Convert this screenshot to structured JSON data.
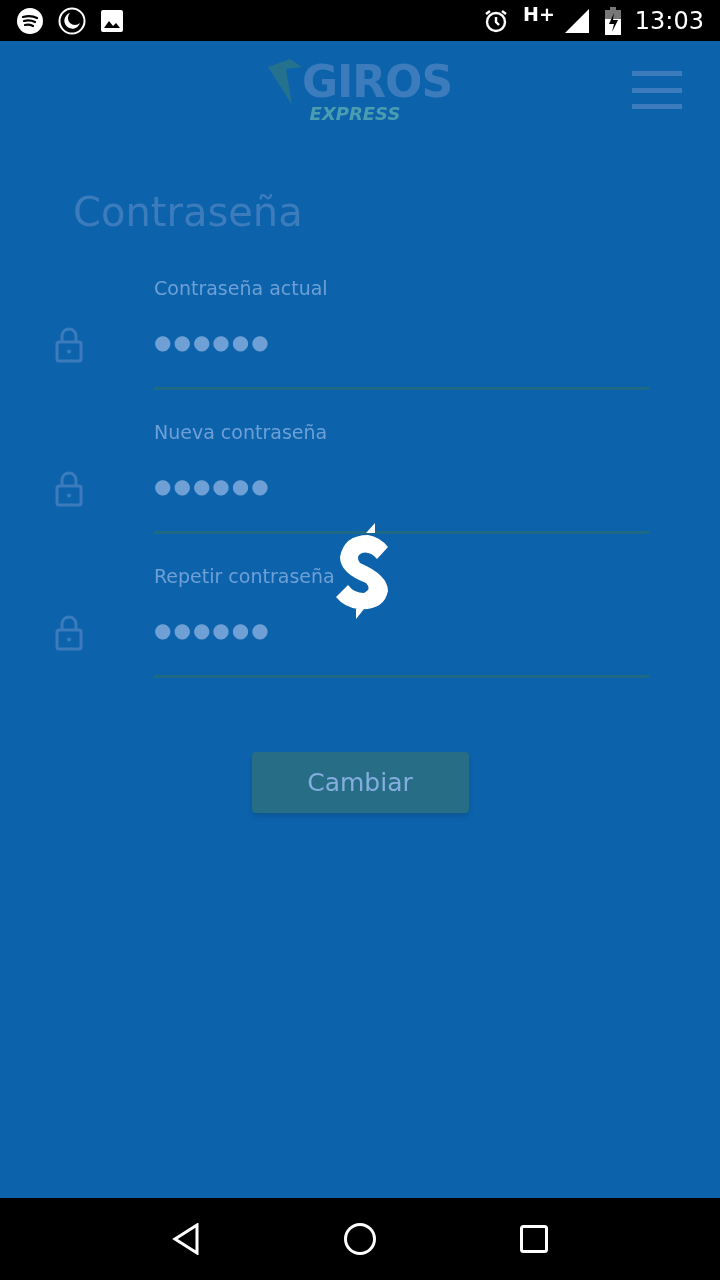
{
  "status_bar": {
    "network": "H+",
    "time": "13:03"
  },
  "header": {
    "logo_main": "GIROS",
    "logo_sub": "EXPRESS"
  },
  "title": "Contraseña",
  "fields": [
    {
      "label": "Contraseña actual",
      "value": "●●●●●●"
    },
    {
      "label": "Nueva contraseña",
      "value": "●●●●●●"
    },
    {
      "label": "Repetir contraseña",
      "value": "●●●●●●"
    }
  ],
  "button": {
    "label": "Cambiar",
    "disabled": true
  },
  "loading": true
}
